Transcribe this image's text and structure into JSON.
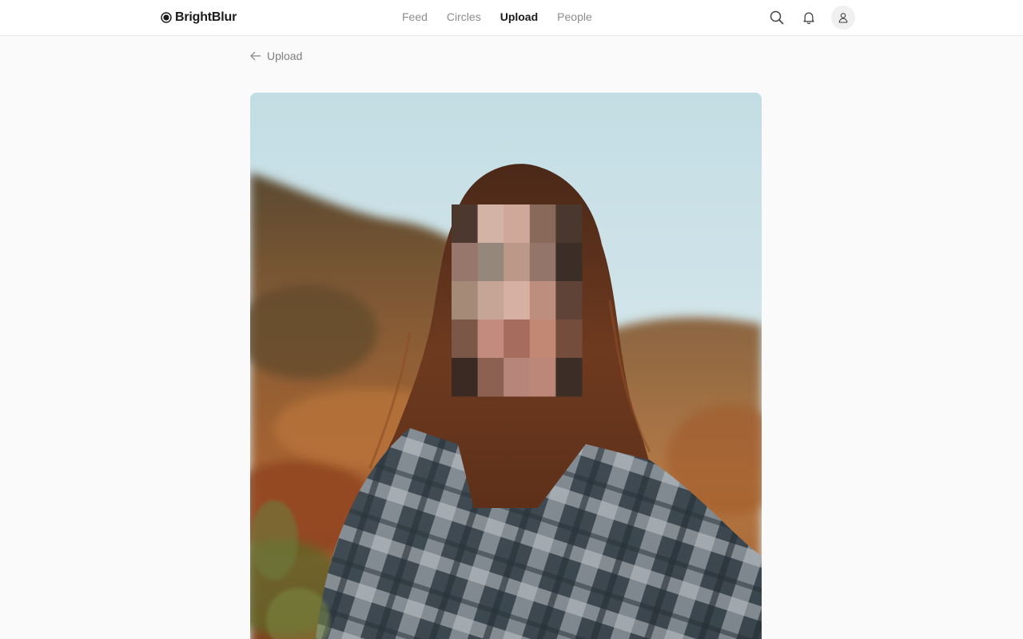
{
  "brand": {
    "name": "BrightBlur",
    "icon": "circle-dot-logo-icon"
  },
  "nav": {
    "items": [
      {
        "label": "Feed",
        "active": false
      },
      {
        "label": "Circles",
        "active": false
      },
      {
        "label": "Upload",
        "active": true
      },
      {
        "label": "People",
        "active": false
      }
    ]
  },
  "header_icons": [
    "search-icon",
    "bell-icon",
    "user-icon"
  ],
  "back": {
    "label": "Upload",
    "icon": "arrow-left-icon"
  },
  "photo": {
    "subject": "person with long wavy hair in plaid flannel shirt outdoors, face pixelated",
    "face_pixel_grid_colors": [
      [
        "#4c382f",
        "#d3b3a6",
        "#cfa899",
        "#89695a",
        "#4a382f"
      ],
      [
        "#97766b",
        "#96877b",
        "#bc9888",
        "#93756a",
        "#3b2e26"
      ],
      [
        "#a58a77",
        "#c6a596",
        "#d6b0a2",
        "#bd8d7e",
        "#5f4336"
      ],
      [
        "#7b5748",
        "#c28b7d",
        "#a66d5e",
        "#c38873",
        "#754d3d"
      ],
      [
        "#3b2a23",
        "#8d6152",
        "#b7857a",
        "#bc8679",
        "#3c2e27"
      ]
    ]
  },
  "colors": {
    "accent_text": "#1b1b1b",
    "muted_text": "#8d8d8d",
    "background": "#fafafa"
  }
}
